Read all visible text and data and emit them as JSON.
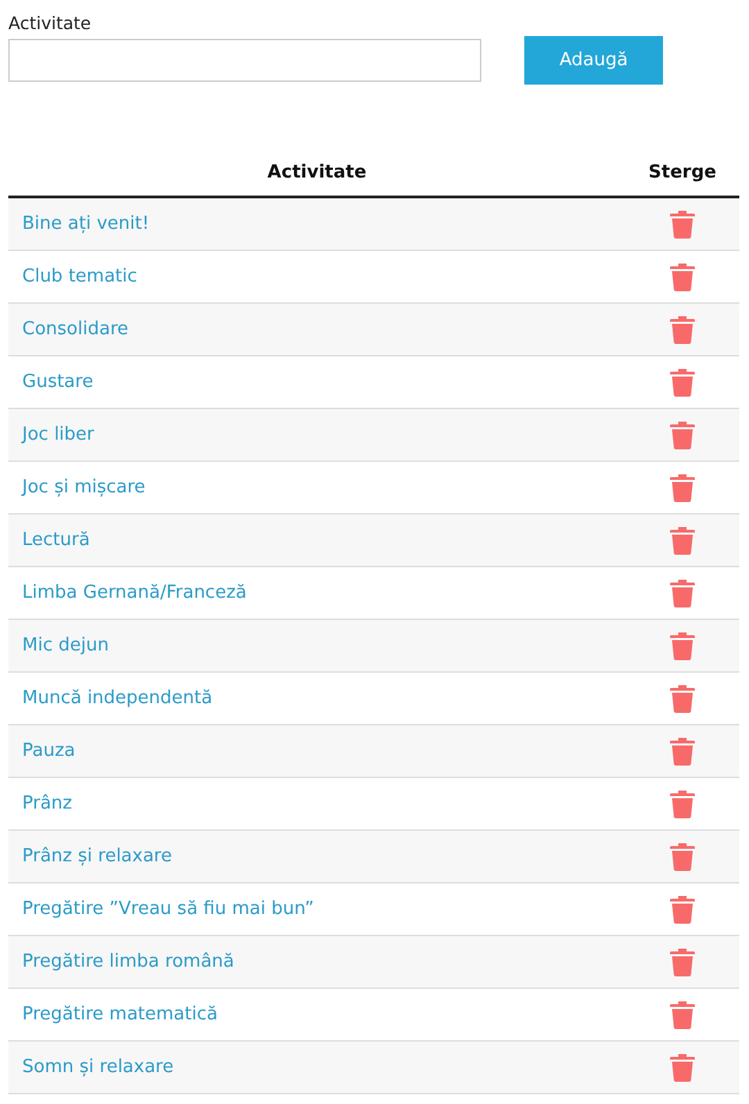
{
  "form": {
    "label": "Activitate",
    "button": "Adaugă"
  },
  "table": {
    "columns": [
      "Activitate",
      "Sterge"
    ],
    "rows": [
      {
        "name": "Bine ați venit!"
      },
      {
        "name": "Club tematic"
      },
      {
        "name": "Consolidare"
      },
      {
        "name": "Gustare"
      },
      {
        "name": "Joc liber"
      },
      {
        "name": "Joc și mișcare"
      },
      {
        "name": "Lectură"
      },
      {
        "name": "Limba Gernană/Franceză"
      },
      {
        "name": "Mic dejun"
      },
      {
        "name": "Muncă independentă"
      },
      {
        "name": "Pauza"
      },
      {
        "name": "Prânz"
      },
      {
        "name": "Prânz și relaxare"
      },
      {
        "name": "Pregătire ”Vreau să fiu mai bun”"
      },
      {
        "name": "Pregătire limba română"
      },
      {
        "name": "Pregătire matematică"
      },
      {
        "name": "Somn și relaxare"
      }
    ]
  }
}
